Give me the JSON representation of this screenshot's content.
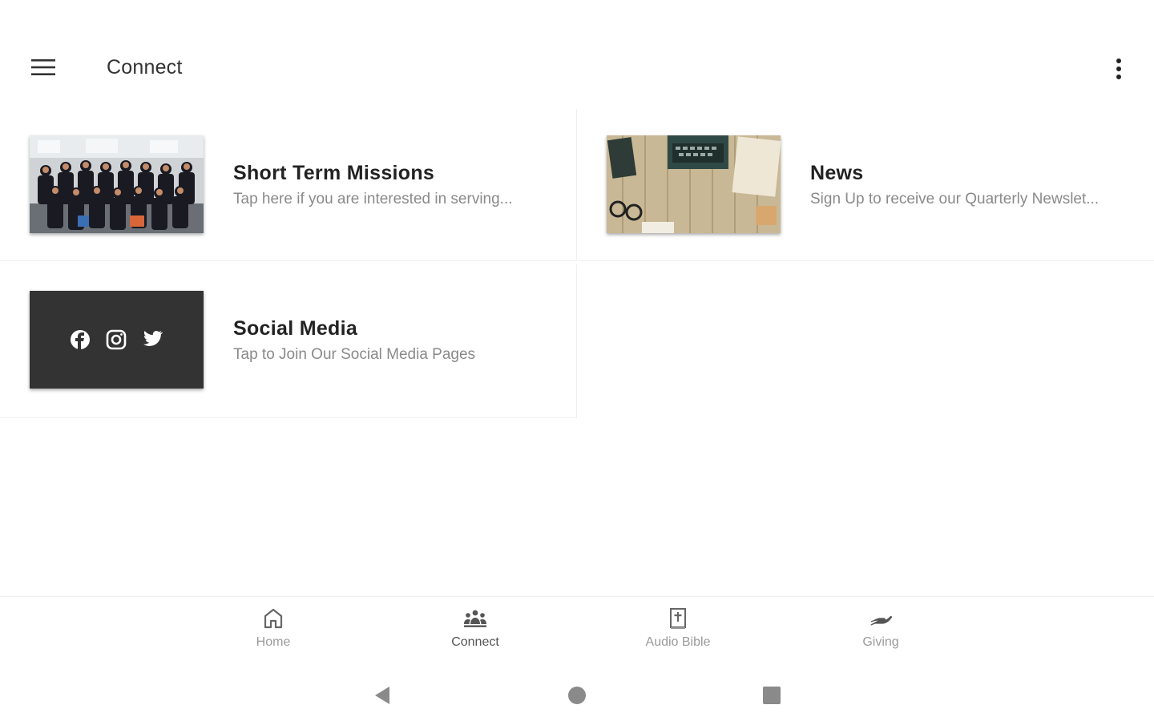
{
  "app_bar": {
    "title": "Connect",
    "menu_icon": "hamburger-menu-icon",
    "overflow_icon": "more-vert-icon"
  },
  "cards": [
    {
      "title": "Short Term Missions",
      "subtitle": "Tap here if you are interested in serving...",
      "thumbnail": "group-photo"
    },
    {
      "title": "News",
      "subtitle": "Sign Up to receive our Quarterly Newslet...",
      "thumbnail": "desk-typewriter-photo"
    },
    {
      "title": "Social Media",
      "subtitle": "Tap to Join Our Social Media Pages",
      "thumbnail": "social-icons-tile",
      "thumbnail_icons": [
        "facebook-icon",
        "instagram-icon",
        "twitter-icon"
      ]
    }
  ],
  "bottom_nav": {
    "items": [
      {
        "label": "Home",
        "icon": "home-icon",
        "active": false
      },
      {
        "label": "Connect",
        "icon": "people-group-icon",
        "active": true
      },
      {
        "label": "Audio Bible",
        "icon": "bible-icon",
        "active": false
      },
      {
        "label": "Giving",
        "icon": "giving-hand-icon",
        "active": false
      }
    ]
  },
  "system_nav": {
    "items": [
      "back-icon",
      "home-circle-icon",
      "recents-square-icon"
    ]
  },
  "colors": {
    "background": "#ffffff",
    "title_text": "#222222",
    "subtitle_text": "#8a8a8a",
    "nav_label": "#9a9a9a",
    "icon": "#666666",
    "divider": "#efefef",
    "social_tile": "#333333"
  }
}
